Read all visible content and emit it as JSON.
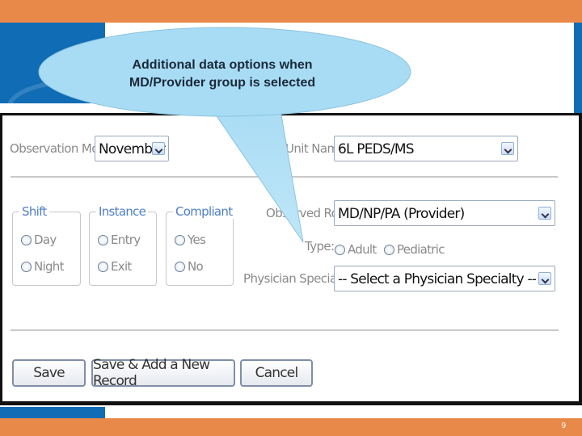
{
  "callout": {
    "text_line1": "Additional data options when",
    "text_line2": "MD/Provider group is selected"
  },
  "form": {
    "observation_month": {
      "label": "Observation Month",
      "value": "November"
    },
    "unit_name": {
      "label": "Unit Name",
      "value": "6L PEDS/MS"
    },
    "shift": {
      "legend": "Shift",
      "options": [
        "Day",
        "Night"
      ]
    },
    "instance": {
      "legend": "Instance",
      "options": [
        "Entry",
        "Exit"
      ]
    },
    "compliant": {
      "legend": "Compliant",
      "options": [
        "Yes",
        "No"
      ]
    },
    "observed_role": {
      "label": "Observed Role",
      "value": "MD/NP/PA (Provider)"
    },
    "type": {
      "label": "Type:",
      "options": [
        "Adult",
        "Pediatric"
      ]
    },
    "physician_specialty": {
      "label": "Physician Specialty",
      "value": "-- Select a Physician Specialty --"
    },
    "buttons": {
      "save": "Save",
      "save_new": "Save & Add a New Record",
      "cancel": "Cancel"
    }
  },
  "footer": {
    "page_number": "9"
  },
  "colors": {
    "orange": "#e8894a",
    "blue": "#0f6cb5",
    "callout": "#a8dcf4",
    "legend": "#4f7fc6"
  }
}
